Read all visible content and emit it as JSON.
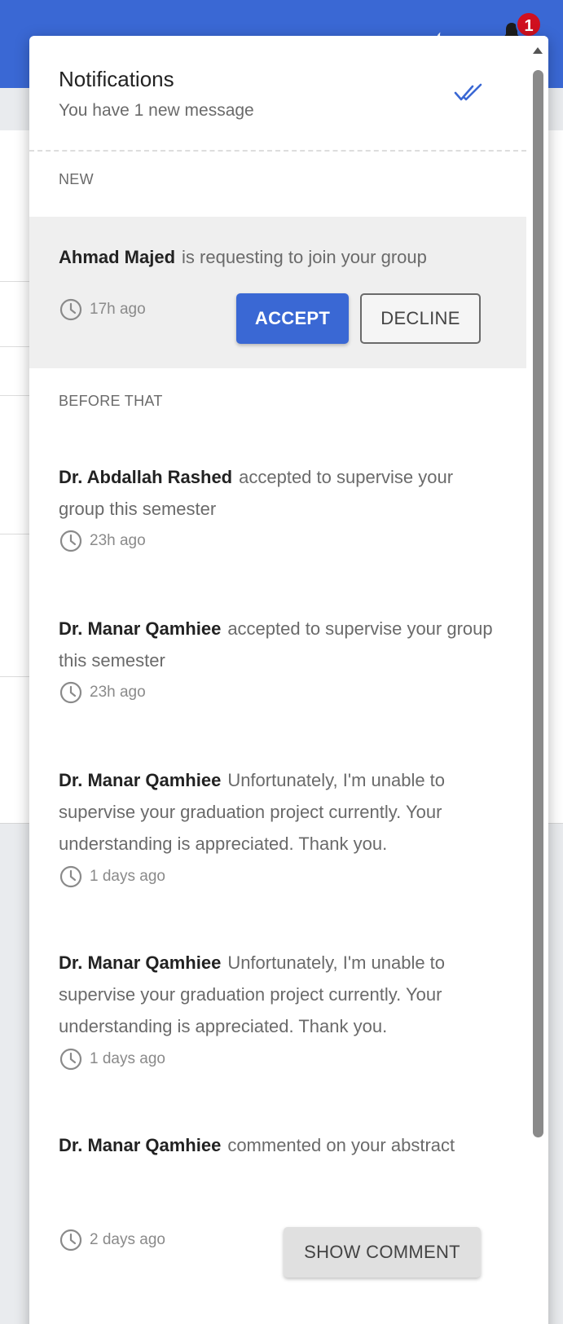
{
  "header": {
    "badge_count": "1",
    "accent_color": "#3a68d4",
    "icons": [
      "moon-icon",
      "bell-icon"
    ]
  },
  "notifications": {
    "title": "Notifications",
    "subtitle": "You have 1 new message",
    "mark_all_read_icon": "double-check-icon",
    "new_label": "NEW",
    "before_label": "BEFORE THAT",
    "new_items": [
      {
        "sender": "Ahmad Majed",
        "text": "is requesting to join your group",
        "time": "17h ago",
        "accept_label": "ACCEPT",
        "decline_label": "DECLINE"
      }
    ],
    "items": [
      {
        "sender": "Dr. Abdallah Rashed",
        "text": "accepted to supervise your group this semester",
        "time": "23h ago"
      },
      {
        "sender": "Dr. Manar Qamhiee",
        "text": "accepted to supervise your group this semester",
        "time": "23h ago"
      },
      {
        "sender": "Dr. Manar Qamhiee",
        "text": "Unfortunately, I'm unable to supervise your graduation project currently. Your understanding is appreciated. Thank you.",
        "time": "1 days ago"
      },
      {
        "sender": "Dr. Manar Qamhiee",
        "text": "Unfortunately, I'm unable to supervise your graduation project currently. Your understanding is appreciated. Thank you.",
        "time": "1 days ago"
      },
      {
        "sender": "Dr. Manar Qamhiee",
        "text": "commented on your abstract",
        "time": "2 days ago",
        "action_label": "SHOW COMMENT"
      }
    ]
  }
}
